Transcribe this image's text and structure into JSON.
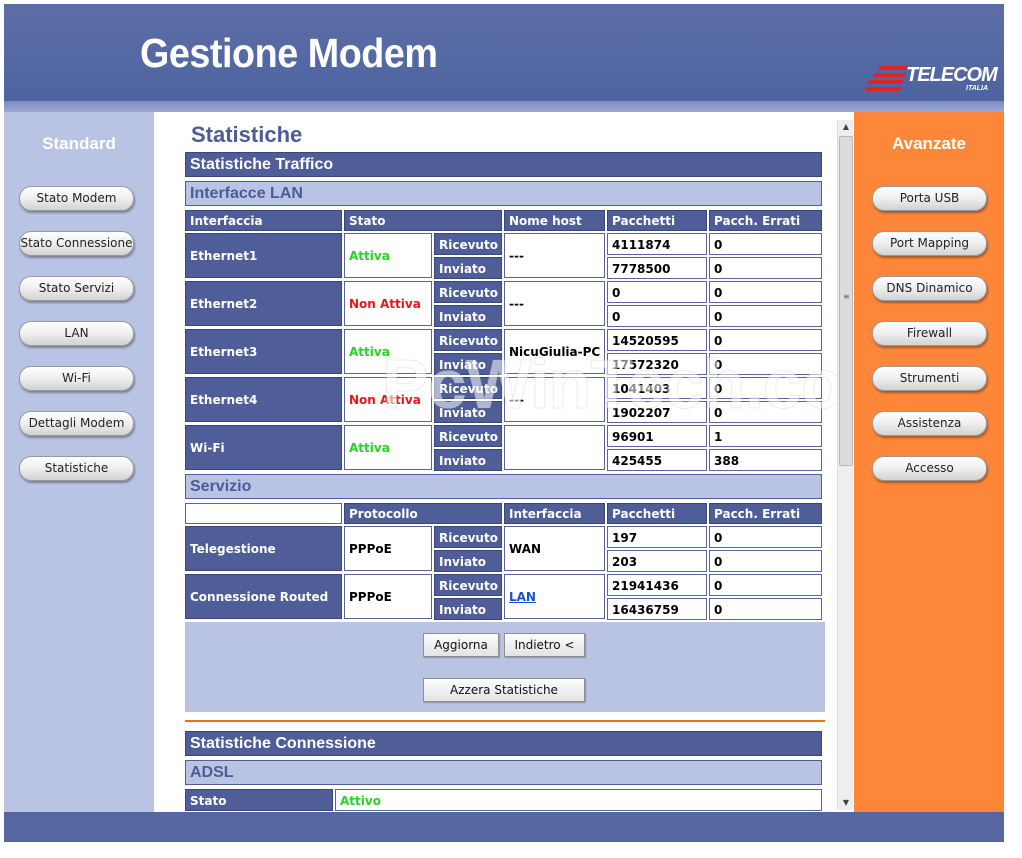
{
  "header": {
    "title": "Gestione Modem",
    "logo": "TELECOM",
    "logo_sub": "ITALIA"
  },
  "left_sidebar": {
    "title": "Standard",
    "items": [
      "Stato Modem",
      "Stato Connessione",
      "Stato Servizi",
      "LAN",
      "Wi-Fi",
      "Dettagli Modem",
      "Statistiche"
    ]
  },
  "right_sidebar": {
    "title": "Avanzate",
    "items": [
      "Porta USB",
      "Port Mapping",
      "DNS Dinamico",
      "Firewall",
      "Strumenti",
      "Assistenza",
      "Accesso"
    ]
  },
  "main": {
    "title": "Statistiche",
    "traffic_section": "Statistiche Traffico",
    "lan_section": "Interfacce LAN",
    "lan_headers": [
      "Interfaccia",
      "Stato",
      "Nome host",
      "Pacchetti",
      "Pacch. Errati"
    ],
    "dir_rx": "Ricevuto",
    "dir_tx": "Inviato",
    "lan_rows": [
      {
        "name": "Ethernet1",
        "status": "Attiva",
        "host": "---",
        "rx_packets": "4111874",
        "rx_errors": "0",
        "tx_packets": "7778500",
        "tx_errors": "0"
      },
      {
        "name": "Ethernet2",
        "status": "Non Attiva",
        "host": "---",
        "rx_packets": "0",
        "rx_errors": "0",
        "tx_packets": "0",
        "tx_errors": "0"
      },
      {
        "name": "Ethernet3",
        "status": "Attiva",
        "host": "NicuGiulia-PC",
        "rx_packets": "14520595",
        "rx_errors": "0",
        "tx_packets": "17572320",
        "tx_errors": "0"
      },
      {
        "name": "Ethernet4",
        "status": "Non Attiva",
        "host": "---",
        "rx_packets": "1041403",
        "rx_errors": "0",
        "tx_packets": "1902207",
        "tx_errors": "0"
      },
      {
        "name": "Wi-Fi",
        "status": "Attiva",
        "host": "",
        "rx_packets": "96901",
        "rx_errors": "1",
        "tx_packets": "425455",
        "tx_errors": "388"
      }
    ],
    "service_section": "Servizio",
    "service_headers": [
      "",
      "Protocollo",
      "Interfaccia",
      "Pacchetti",
      "Pacch. Errati"
    ],
    "service_rows": [
      {
        "name": "Telegestione",
        "protocol": "PPPoE",
        "interface": "WAN",
        "rx_packets": "197",
        "rx_errors": "0",
        "tx_packets": "203",
        "tx_errors": "0"
      },
      {
        "name": "Connessione Routed",
        "protocol": "PPPoE",
        "interface": "LAN",
        "rx_packets": "21941436",
        "rx_errors": "0",
        "tx_packets": "16436759",
        "tx_errors": "0"
      }
    ],
    "buttons": {
      "refresh": "Aggiorna",
      "back": "Indietro <",
      "reset": "Azzera Statistiche"
    },
    "connection_section": "Statistiche Connessione",
    "adsl_section": "ADSL",
    "adsl_status_label": "Stato",
    "adsl_status_value": "Attivo",
    "watermark": "PcWinTech.com"
  },
  "colors": {
    "header": "#5468a3",
    "left_sidebar": "#b9c4e5",
    "right_sidebar": "#fe8639",
    "table_header": "#4f5e98",
    "active": "#22d522",
    "inactive": "#e8151b"
  }
}
